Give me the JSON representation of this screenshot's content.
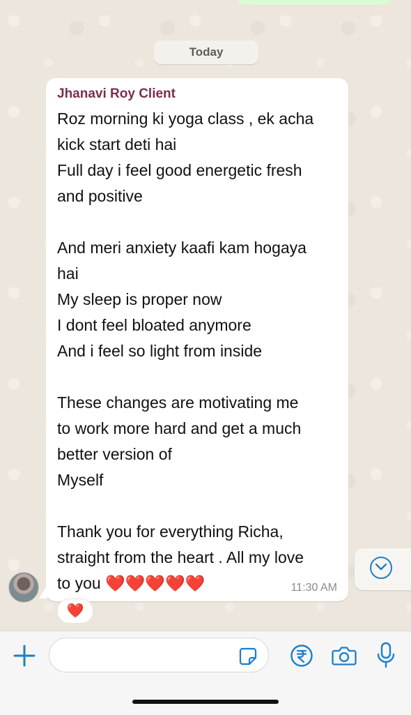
{
  "chat": {
    "date_label": "Today",
    "message": {
      "sender": "Jhanavi Roy Client",
      "body": "Roz morning ki yoga class , ek acha\nkick start deti hai\nFull day i feel good energetic fresh\nand positive\n\nAnd meri anxiety kaafi kam hogaya\nhai\nMy sleep is proper now\nI dont feel bloated anymore\nAnd i feel so light from inside\n\nThese changes are motivating me\nto work more hard and get a much\nbetter version of\nMyself\n\nThank you for everything Richa,\nstraight from the heart . All my love\nto you ",
      "hearts": "❤️❤️❤️❤️❤️",
      "time": "11:30 AM",
      "reaction": "❤️"
    }
  },
  "icons": {
    "scroll": "chevron-down-icon",
    "attach": "plus-icon",
    "sticker": "sticker-icon",
    "payment": "rupee-icon",
    "camera": "camera-icon",
    "mic": "microphone-icon"
  },
  "colors": {
    "accent": "#1c7ecb",
    "sender": "#7a2f4f",
    "heart": "#e0202c",
    "chat_bg": "#ece6dc"
  }
}
